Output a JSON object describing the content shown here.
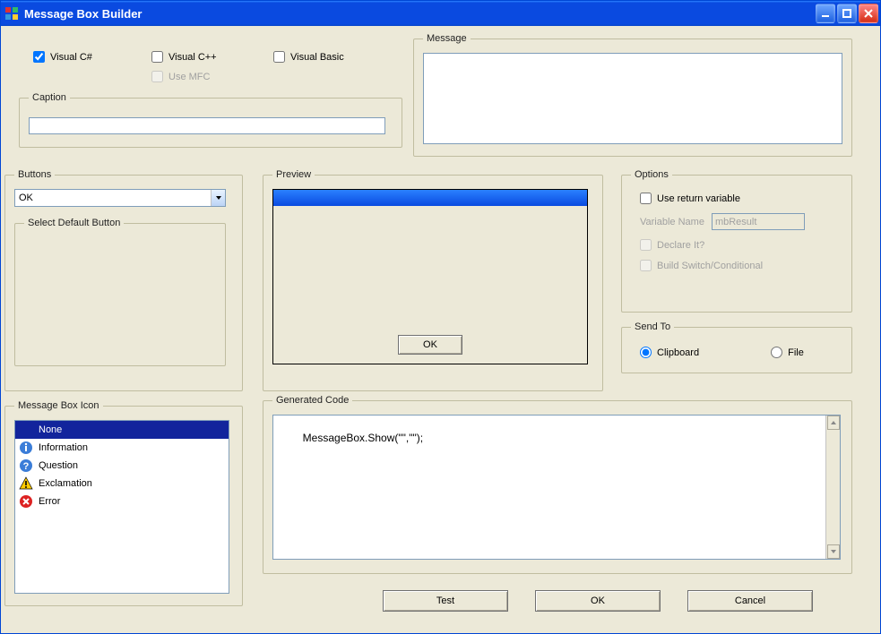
{
  "window": {
    "title": "Message Box Builder"
  },
  "lang": {
    "csharp": {
      "label": "Visual C#",
      "checked": true
    },
    "cpp": {
      "label": "Visual C++",
      "checked": false
    },
    "vb": {
      "label": "Visual Basic",
      "checked": false
    },
    "use_mfc": {
      "label": "Use MFC",
      "checked": false
    }
  },
  "caption": {
    "legend": "Caption",
    "value": ""
  },
  "message": {
    "legend": "Message",
    "value": ""
  },
  "buttons": {
    "legend": "Buttons",
    "selected": "OK",
    "default_group": "Select Default Button"
  },
  "preview": {
    "legend": "Preview",
    "ok_label": "OK"
  },
  "options": {
    "legend": "Options",
    "use_return": {
      "label": "Use return variable",
      "checked": false
    },
    "var_label": "Variable Name",
    "var_value": "mbResult",
    "declare": {
      "label": "Declare It?",
      "checked": false
    },
    "switch": {
      "label": "Build Switch/Conditional",
      "checked": false
    }
  },
  "sendto": {
    "legend": "Send To",
    "clipboard": "Clipboard",
    "file": "File",
    "selected": "clipboard"
  },
  "icons": {
    "legend": "Message Box Icon",
    "items": [
      {
        "label": "None",
        "icon": "none",
        "selected": true
      },
      {
        "label": "Information",
        "icon": "info",
        "selected": false
      },
      {
        "label": "Question",
        "icon": "quest",
        "selected": false
      },
      {
        "label": "Exclamation",
        "icon": "excl",
        "selected": false
      },
      {
        "label": "Error",
        "icon": "err",
        "selected": false
      }
    ]
  },
  "code": {
    "legend": "Generated Code",
    "text": "MessageBox.Show(\"\",\"\");"
  },
  "footer": {
    "test": "Test",
    "ok": "OK",
    "cancel": "Cancel"
  }
}
